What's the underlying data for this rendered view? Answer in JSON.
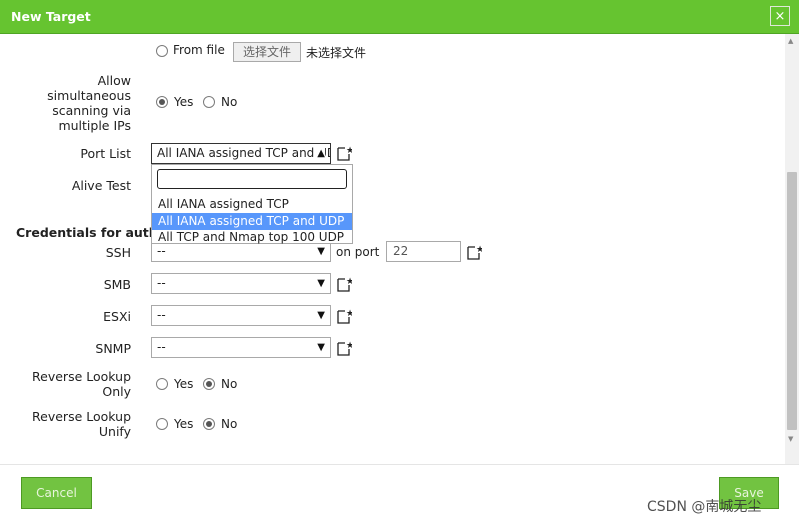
{
  "dialog": {
    "title": "New Target",
    "close_symbol": "×"
  },
  "from_file": {
    "label": "From file",
    "button": "选择文件",
    "status": "未选择文件"
  },
  "allow_simultaneous": {
    "label": "Allow simultaneous scanning via multiple IPs",
    "yes": "Yes",
    "no": "No",
    "selected": "Yes"
  },
  "port_list": {
    "label": "Port List",
    "value": "All IANA assigned TCP and UDP",
    "dropdown": {
      "search_value": "",
      "options": [
        "All IANA assigned TCP",
        "All IANA assigned TCP and UDP",
        "All TCP and Nmap top 100 UDP"
      ],
      "highlighted": "All IANA assigned TCP and UDP"
    }
  },
  "alive_test": {
    "label": "Alive Test"
  },
  "credentials": {
    "heading": "Credentials for authe",
    "ssh": {
      "label": "SSH",
      "value": "--",
      "on_port": "on port",
      "port": "22"
    },
    "smb": {
      "label": "SMB",
      "value": "--"
    },
    "esxi": {
      "label": "ESXi",
      "value": "--"
    },
    "snmp": {
      "label": "SNMP",
      "value": "--"
    }
  },
  "reverse_lookup_only": {
    "label": "Reverse Lookup Only",
    "yes": "Yes",
    "no": "No",
    "selected": "No"
  },
  "reverse_lookup_unify": {
    "label": "Reverse Lookup Unify",
    "yes": "Yes",
    "no": "No",
    "selected": "No"
  },
  "footer": {
    "cancel": "Cancel",
    "save": "Save"
  },
  "watermark": "CSDN @南城无尘",
  "colors": {
    "accent": "#66c430",
    "highlight": "#5897fb"
  }
}
